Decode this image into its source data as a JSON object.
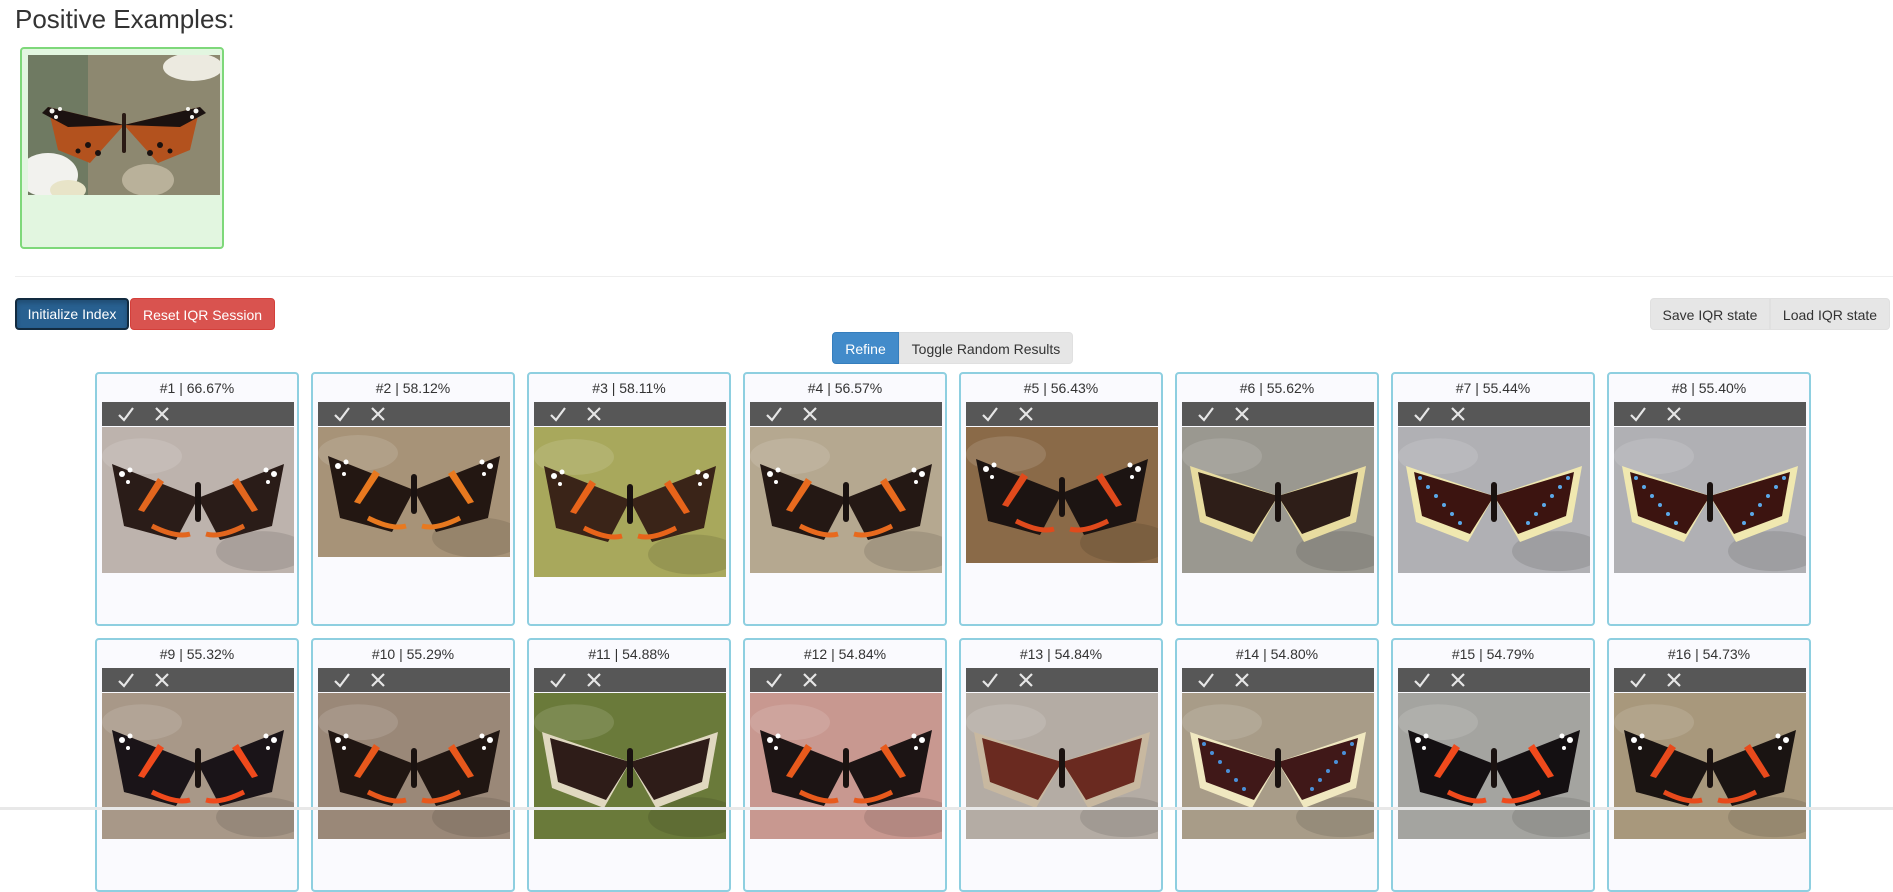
{
  "positive": {
    "title": "Positive Examples:",
    "images": [
      {
        "icon": "painted-lady-butterfly-image"
      }
    ]
  },
  "toolbar": {
    "init_label": "Initialize Index",
    "reset_label": "Reset IQR Session",
    "save_label": "Save IQR state",
    "load_label": "Load IQR state",
    "refine_label": "Refine",
    "toggle_label": "Toggle Random Results"
  },
  "results": [
    {
      "label": "#1 | 66.67%",
      "icon": "red-admiral-butterfly-image",
      "bg": "#bdb3ad",
      "wing": "#2a1c18",
      "band": "#e2661e",
      "spot": "#ffffff",
      "edge": ""
    },
    {
      "label": "#2 | 58.12%",
      "icon": "red-admiral-butterfly-image",
      "bg": "#a79378",
      "wing": "#231712",
      "band": "#e8791f",
      "spot": "#ffffff",
      "edge": ""
    },
    {
      "label": "#3 | 58.11%",
      "icon": "red-admiral-butterfly-image",
      "bg": "#a8a85c",
      "wing": "#3a2418",
      "band": "#e8641a",
      "spot": "#ffffff",
      "edge": ""
    },
    {
      "label": "#4 | 56.57%",
      "icon": "red-admiral-butterfly-image",
      "bg": "#b5a890",
      "wing": "#241814",
      "band": "#e86a1e",
      "spot": "#ffffff",
      "edge": ""
    },
    {
      "label": "#5 | 56.43%",
      "icon": "red-admiral-butterfly-image",
      "bg": "#8a6a48",
      "wing": "#1c1412",
      "band": "#e04a1c",
      "spot": "#ffffff",
      "edge": ""
    },
    {
      "label": "#6 | 55.62%",
      "icon": "mourning-cloak-butterfly-image",
      "bg": "#9a9890",
      "wing": "#2e1e18",
      "band": "",
      "spot": "",
      "edge": "#e8dca0"
    },
    {
      "label": "#7 | 55.44%",
      "icon": "mourning-cloak-butterfly-image",
      "bg": "#b0b0b4",
      "wing": "#3c1410",
      "band": "",
      "spot": "#5aa8e8",
      "edge": "#f0e8b0"
    },
    {
      "label": "#8 | 55.40%",
      "icon": "mourning-cloak-butterfly-image",
      "bg": "#b0b0b4",
      "wing": "#3c1410",
      "band": "",
      "spot": "#5aa8e8",
      "edge": "#f0e8b0"
    },
    {
      "label": "#9 | 55.32%",
      "icon": "red-admiral-butterfly-image",
      "bg": "#a89888",
      "wing": "#1a1418",
      "band": "#f04a1c",
      "spot": "#ffffff",
      "edge": ""
    },
    {
      "label": "#10 | 55.29%",
      "icon": "red-admiral-butterfly-image",
      "bg": "#9a8878",
      "wing": "#201612",
      "band": "#e8581c",
      "spot": "#ffffff",
      "edge": ""
    },
    {
      "label": "#11 | 54.88%",
      "icon": "mourning-cloak-butterfly-image",
      "bg": "#6a7a3a",
      "wing": "#2e1c18",
      "band": "",
      "spot": "",
      "edge": "#e0d8c0"
    },
    {
      "label": "#12 | 54.84%",
      "icon": "red-admiral-butterfly-image",
      "bg": "#c89890",
      "wing": "#1c1414",
      "band": "#e85a1c",
      "spot": "#ffffff",
      "edge": ""
    },
    {
      "label": "#13 | 54.84%",
      "icon": "mourning-cloak-butterfly-image",
      "bg": "#b4aca4",
      "wing": "#6a2a20",
      "band": "",
      "spot": "",
      "edge": "#c8b8a0"
    },
    {
      "label": "#14 | 54.80%",
      "icon": "mourning-cloak-butterfly-image",
      "bg": "#a89c88",
      "wing": "#401818",
      "band": "",
      "spot": "#4a90d8",
      "edge": "#f0e8c0"
    },
    {
      "label": "#15 | 54.79%",
      "icon": "red-admiral-butterfly-image",
      "bg": "#a4a4a0",
      "wing": "#141012",
      "band": "#f04a1c",
      "spot": "#ffffff",
      "edge": ""
    },
    {
      "label": "#16 | 54.73%",
      "icon": "red-admiral-butterfly-image",
      "bg": "#a8987c",
      "wing": "#1a1412",
      "band": "#e84a1c",
      "spot": "#ffffff",
      "edge": ""
    }
  ],
  "colors": {
    "positive_bg": "#e2f6e0",
    "positive_border": "#7ed87a",
    "result_border": "#8ecfe0",
    "primary": "#428bca",
    "danger": "#d9534f",
    "vote_bar": "#575757"
  }
}
